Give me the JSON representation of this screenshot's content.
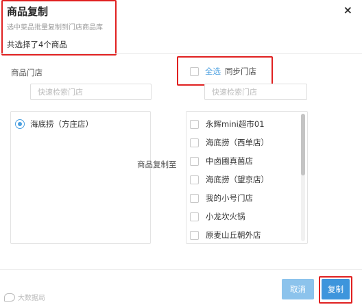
{
  "dialog": {
    "title": "商品复制",
    "subtitle": "选中菜品批量复制到门店商品库",
    "selected_count": "共选择了4个商品",
    "close_glyph": "×"
  },
  "source": {
    "label": "商品门店",
    "search_placeholder": "快速检索门店",
    "stores": [
      {
        "name": "海底捞（方庄店）",
        "selected": true
      }
    ]
  },
  "target": {
    "select_all_label": "全选",
    "sync_label": "同步门店",
    "search_placeholder": "快速检索门店",
    "copy_to_label": "商品复制至",
    "stores": [
      {
        "name": "永辉mini超市01",
        "checked": false
      },
      {
        "name": "海底捞（西单店）",
        "checked": false
      },
      {
        "name": "中卤圃真菌店",
        "checked": false
      },
      {
        "name": "海底捞（望京店）",
        "checked": false
      },
      {
        "name": "我的小号门店",
        "checked": false
      },
      {
        "name": "小龙坎火锅",
        "checked": false
      },
      {
        "name": "原麦山丘朝外店",
        "checked": false
      }
    ]
  },
  "footer": {
    "cancel_label": "取消",
    "copy_label": "复制"
  },
  "watermark": {
    "text": "大数据局"
  },
  "colors": {
    "accent": "#4a9fe0",
    "primary_button": "#3d95dc",
    "cancel_button": "#8cc3ec",
    "highlight": "#e02020"
  }
}
